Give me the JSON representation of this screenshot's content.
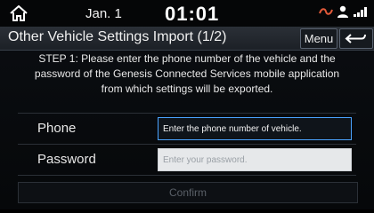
{
  "status_bar": {
    "date": "Jan. 1",
    "time": "01:01"
  },
  "header": {
    "title": "Other Vehicle Settings Import (1/2)",
    "menu_label": "Menu"
  },
  "instructions": {
    "text": "STEP 1: Please enter the phone number of the vehicle and the password of the Genesis Connected Services mobile application from which settings will be exported."
  },
  "form": {
    "phone": {
      "label": "Phone",
      "placeholder": "Enter the phone number of vehicle."
    },
    "password": {
      "label": "Password",
      "placeholder": "Enter your password."
    },
    "confirm_label": "Confirm"
  },
  "icons": {
    "home": "home-icon",
    "back": "back-arrow-icon",
    "status": [
      "connected-services-icon",
      "user-profile-icon",
      "signal-strength-icon"
    ]
  },
  "colors": {
    "accent_blue": "#4aa3ff",
    "background": "#06080a"
  }
}
